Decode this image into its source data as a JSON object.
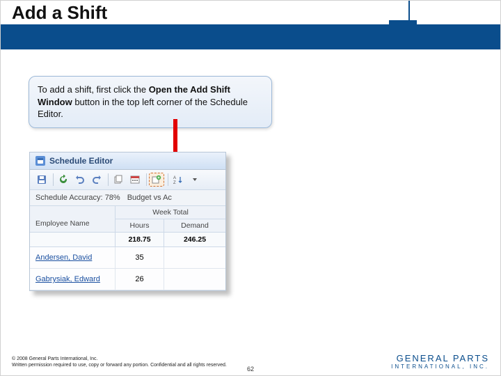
{
  "title": "Add a Shift",
  "callout": {
    "pre": "To add a shift, first click the ",
    "bold": "Open the Add Shift Window",
    "post": " button in the top left corner of the Schedule Editor."
  },
  "editor": {
    "title": "Schedule Editor",
    "status": {
      "accuracy_label": "Schedule Accuracy:",
      "accuracy_value": "78%",
      "budget_label": "Budget vs Ac"
    },
    "columns": {
      "employee": "Employee Name",
      "week_total": "Week Total",
      "hours": "Hours",
      "demand": "Demand"
    },
    "totals": {
      "hours": "218.75",
      "demand": "246.25"
    },
    "rows": [
      {
        "name": "Andersen, David",
        "hours": "35"
      },
      {
        "name": "Gabrysiak, Edward",
        "hours": "26"
      }
    ]
  },
  "footer": {
    "copyright": "© 2008 General Parts International, Inc.",
    "confidential": "Written permission required to use, copy or forward any portion. Confidential and all rights reserved.",
    "page_number": "62",
    "brand": "GENERAL PARTS",
    "brand_sub": "INTERNATIONAL, INC."
  }
}
